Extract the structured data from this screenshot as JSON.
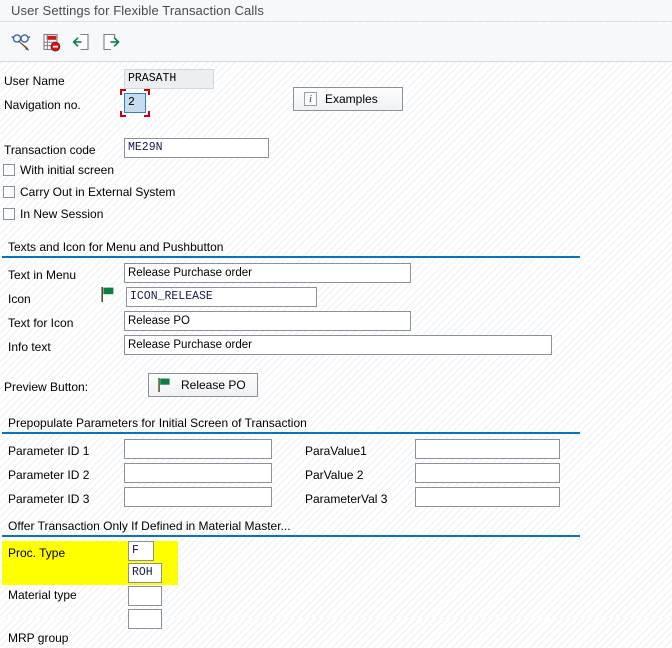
{
  "window": {
    "title": "User Settings for Flexible Transaction Calls"
  },
  "toolbar": {
    "items": [
      {
        "name": "display-change-icon",
        "tooltip": "Display <-> Change"
      },
      {
        "name": "delete-row-icon",
        "tooltip": "Delete"
      },
      {
        "name": "back-icon",
        "tooltip": "Back"
      },
      {
        "name": "exit-icon",
        "tooltip": "Exit"
      }
    ]
  },
  "header_form": {
    "user_name_label": "User Name",
    "user_name_value": "PRASATH",
    "navigation_no_label": "Navigation no.",
    "navigation_no_value": "2",
    "examples_button_label": "Examples",
    "examples_icon": "info-icon"
  },
  "transaction": {
    "code_label": "Transaction code",
    "code_value": "ME29N",
    "checkboxes": [
      {
        "label": "With initial screen",
        "checked": false
      },
      {
        "label": "Carry Out in External System",
        "checked": false
      },
      {
        "label": "In New Session",
        "checked": false
      }
    ]
  },
  "texts_icon_group": {
    "title": "Texts and Icon for Menu and Pushbutton",
    "rows": [
      {
        "label": "Text in Menu",
        "value": "Release Purchase order"
      },
      {
        "label": "Icon",
        "value": "ICON_RELEASE",
        "icon": "green-flag-icon"
      },
      {
        "label": "Text for Icon",
        "value": "Release PO"
      },
      {
        "label": "Info text",
        "value": "Release Purchase order"
      }
    ]
  },
  "preview": {
    "label": "Preview Button:",
    "button_label": "Release PO",
    "button_icon": "green-flag-icon"
  },
  "prepopulate_group": {
    "title": "Prepopulate Parameters for Initial Screen of Transaction",
    "rows": [
      {
        "id_label": "Parameter ID 1",
        "id_value": "",
        "val_label": "ParaValue1",
        "val_value": ""
      },
      {
        "id_label": "Parameter ID 2",
        "id_value": "",
        "val_label": "ParValue 2",
        "val_value": ""
      },
      {
        "id_label": "Parameter ID 3",
        "id_value": "",
        "val_label": "ParameterVal 3",
        "val_value": ""
      }
    ]
  },
  "material_master_group": {
    "title": "Offer Transaction Only If Defined in Material Master...",
    "rows": [
      {
        "label": "Proc. Type",
        "value": "F",
        "highlighted": true
      },
      {
        "label": "Material type",
        "value": "ROH",
        "highlighted": true
      },
      {
        "label": "MRP group",
        "value": "",
        "highlighted": false
      }
    ]
  },
  "colors": {
    "accent": "#0a73bb",
    "highlight": "#ffff00",
    "focus_marker": "#cc0000",
    "icon_green": "#0a8043",
    "icon_red": "#cc0000"
  }
}
